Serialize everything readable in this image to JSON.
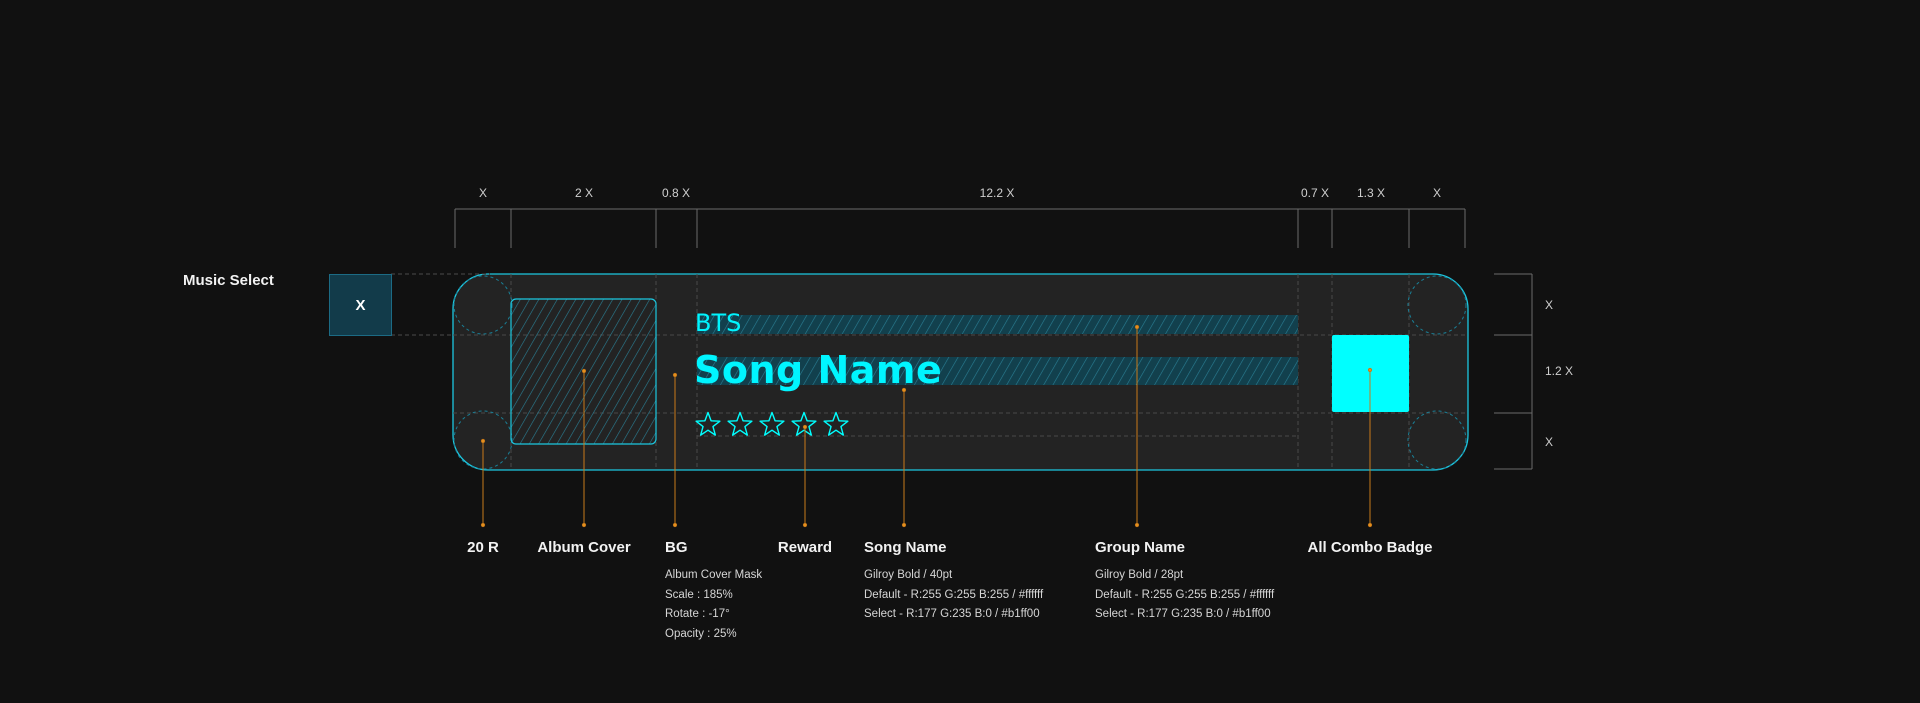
{
  "title": "Music Select",
  "unit_box": "X",
  "top_dimensions": [
    "X",
    "2 X",
    "0.8 X",
    "12.2 X",
    "0.7 X",
    "1.3 X",
    "X"
  ],
  "side_dimensions": [
    "X",
    "1.2 X",
    "X"
  ],
  "card": {
    "artist": "BTS",
    "song_title": "Song Name",
    "stars": 5,
    "badge_color": "#00ffff",
    "accent_color": "#1cc7e0"
  },
  "callouts": {
    "corner_radius": {
      "title": "20 R"
    },
    "album_cover": {
      "title": "Album Cover"
    },
    "bg": {
      "title": "BG",
      "specs": [
        "Album Cover Mask",
        "Scale : 185%",
        "Rotate : -17°",
        "Opacity : 25%"
      ]
    },
    "reward": {
      "title": "Reward"
    },
    "song_name": {
      "title": "Song Name",
      "specs": [
        "Gilroy Bold  /  40pt",
        "Default - R:255  G:255  B:255  /  #ffffff",
        "Select - R:177  G:235  B:0  /  #b1ff00"
      ]
    },
    "group_name": {
      "title": "Group Name",
      "specs": [
        "Gilroy Bold  /  28pt",
        "Default - R:255  G:255  B:255  /  #ffffff",
        "Select - R:177  G:235  B:0  /  #b1ff00"
      ]
    },
    "all_combo_badge": {
      "title": "All Combo Badge"
    }
  }
}
